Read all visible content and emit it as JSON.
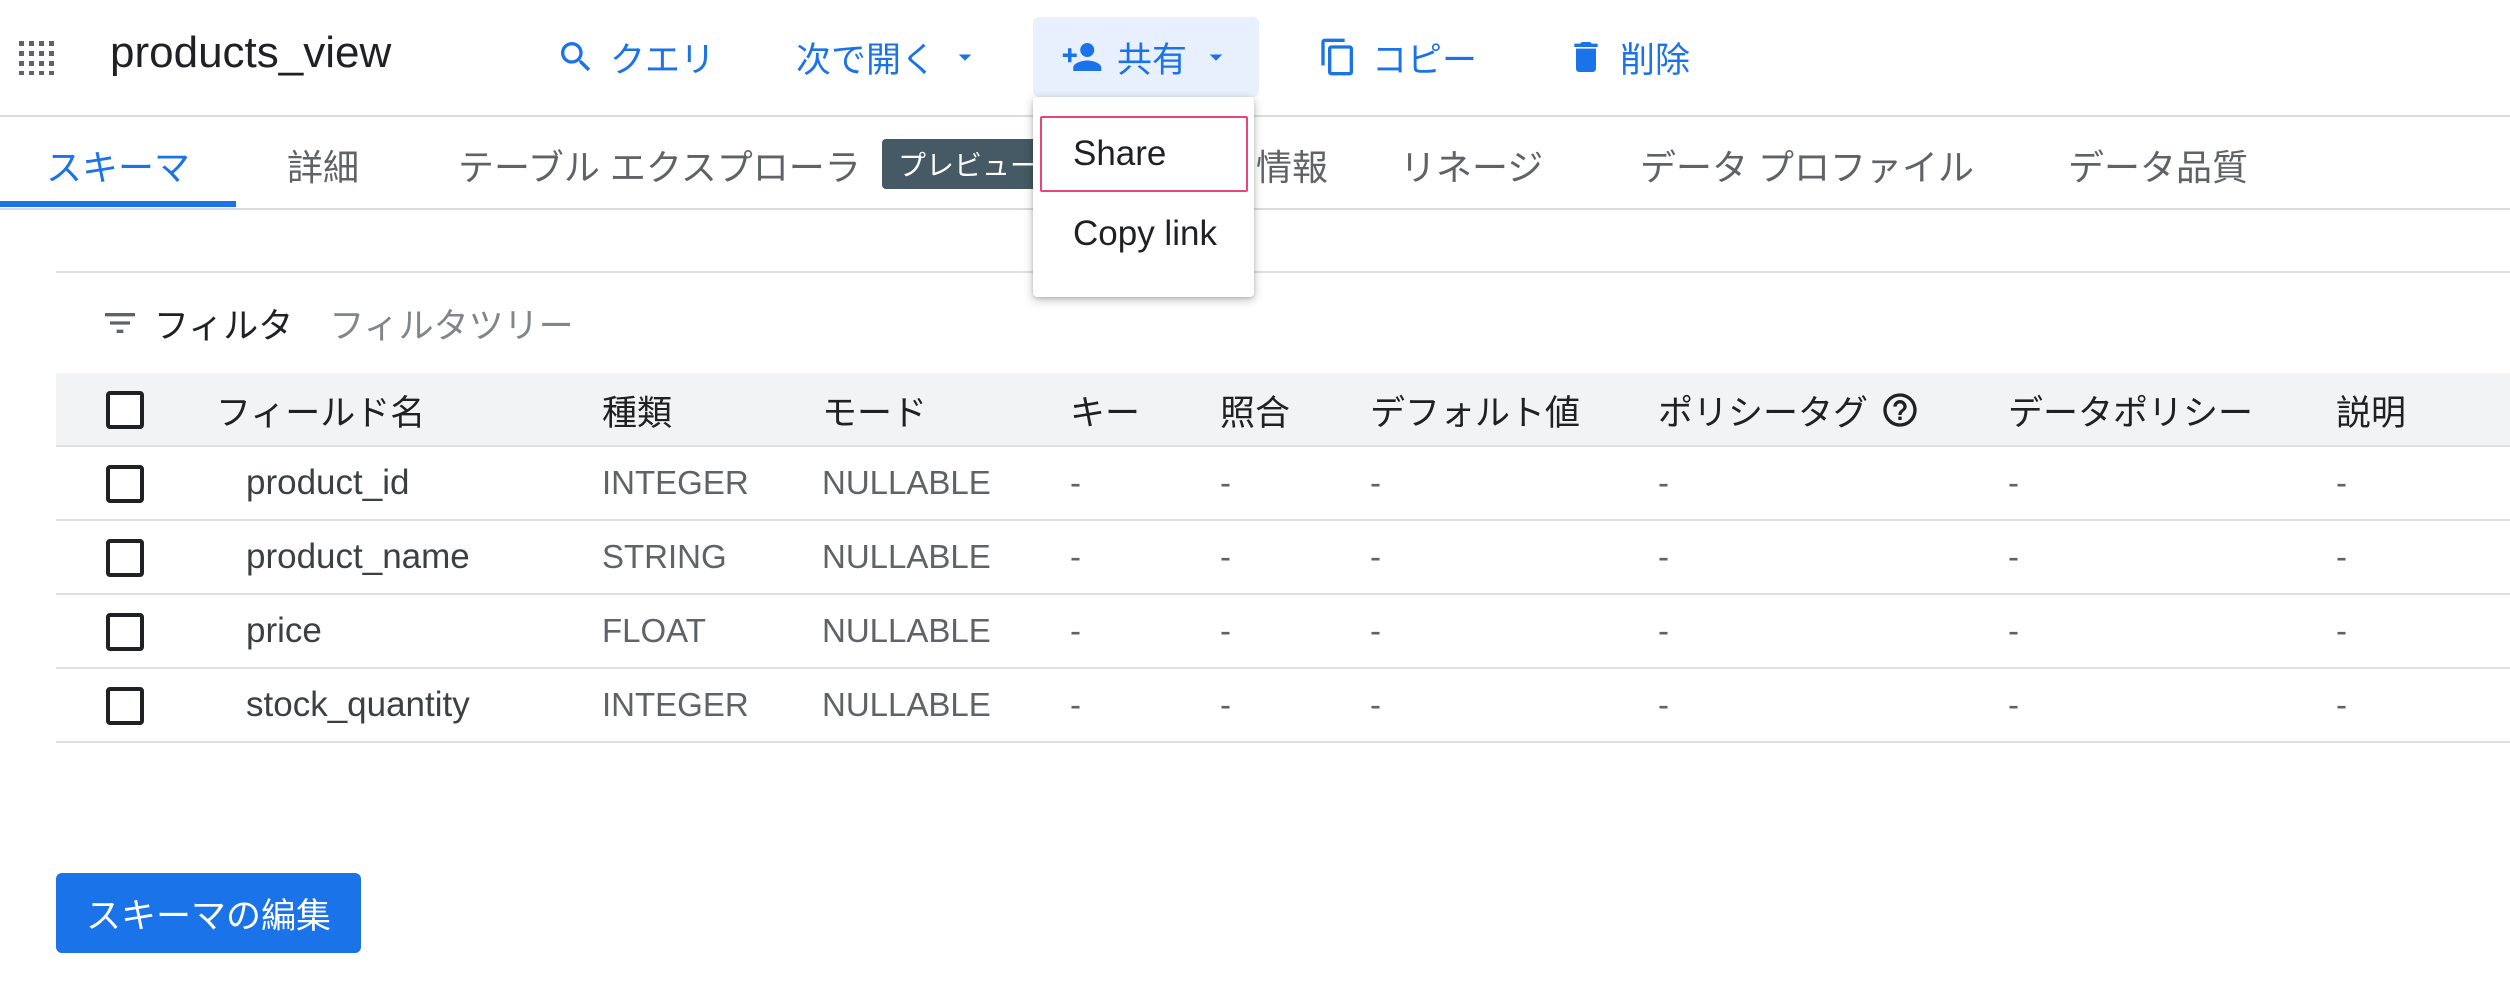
{
  "header": {
    "title": "products_view",
    "toolbar": {
      "query_label": "クエリ",
      "open_with_label": "次で開く",
      "share_label": "共有",
      "copy_label": "コピー",
      "delete_label": "削除"
    }
  },
  "share_menu": {
    "items": [
      "Share",
      "Copy link"
    ],
    "focused": "Share"
  },
  "tabs": {
    "items": [
      "スキーマ",
      "詳細",
      "テーブル エクスプローラ",
      "情報",
      "リネージ",
      "データ プロファイル",
      "データ品質"
    ],
    "selected": "スキーマ",
    "preview_badge": "プレビュー"
  },
  "filter": {
    "label": "フィルタ",
    "placeholder": "フィルタツリー"
  },
  "schema_table": {
    "headers": {
      "field_name": "フィールド名",
      "type": "種類",
      "mode": "モード",
      "key": "キー",
      "collation": "照合",
      "default_value": "デフォルト値",
      "policy_tags": "ポリシータグ",
      "data_policy": "データポリシー",
      "description": "説明"
    },
    "rows": [
      {
        "name": "product_id",
        "type": "INTEGER",
        "mode": "NULLABLE",
        "key": "-",
        "collation": "-",
        "default": "-",
        "policy_tags": "-",
        "data_policy": "-",
        "description": "-"
      },
      {
        "name": "product_name",
        "type": "STRING",
        "mode": "NULLABLE",
        "key": "-",
        "collation": "-",
        "default": "-",
        "policy_tags": "-",
        "data_policy": "-",
        "description": "-"
      },
      {
        "name": "price",
        "type": "FLOAT",
        "mode": "NULLABLE",
        "key": "-",
        "collation": "-",
        "default": "-",
        "policy_tags": "-",
        "data_policy": "-",
        "description": "-"
      },
      {
        "name": "stock_quantity",
        "type": "INTEGER",
        "mode": "NULLABLE",
        "key": "-",
        "collation": "-",
        "default": "-",
        "policy_tags": "-",
        "data_policy": "-",
        "description": "-"
      }
    ]
  },
  "edit_schema_label": "スキーマの編集",
  "colors": {
    "accent": "#1a73e8",
    "badge": "#455a64",
    "focus_outline": "#e8457a",
    "active_button_bg": "#e8f0fe"
  },
  "icons": {
    "apps": "apps-grid-icon",
    "query": "search-icon",
    "open_with": "chevron-down-icon",
    "share": "person-add-icon",
    "copy": "content-copy-icon",
    "delete": "trash-icon",
    "filter": "filter-list-icon",
    "help": "help-circle-icon"
  }
}
